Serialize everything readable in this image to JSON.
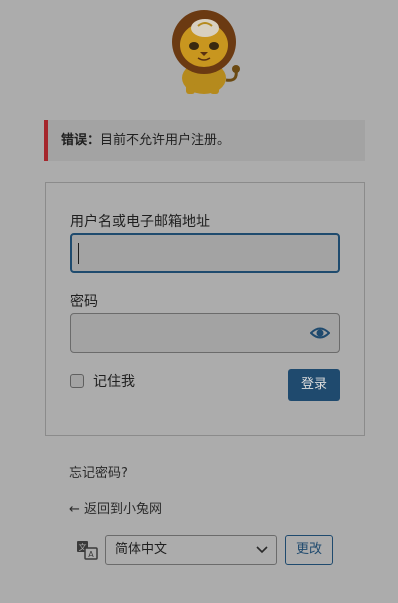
{
  "error": {
    "label": "错误：",
    "message": "目前不允许用户注册。"
  },
  "form": {
    "username_label": "用户名或电子邮箱地址",
    "username_value": "",
    "password_label": "密码",
    "password_value": "",
    "remember_label": "记住我",
    "submit_label": "登录"
  },
  "links": {
    "lost_password": "忘记密码?",
    "back_to_site": "← 返回到小兔网"
  },
  "language": {
    "selected": "简体中文",
    "change_label": "更改"
  },
  "icons": {
    "logo": "lion-mascot-logo",
    "password_toggle": "eye-icon",
    "language": "translate-icon",
    "select": "chevron-down-icon"
  },
  "colors": {
    "primary": "#1f4a6e",
    "error_border": "#a5262c"
  }
}
